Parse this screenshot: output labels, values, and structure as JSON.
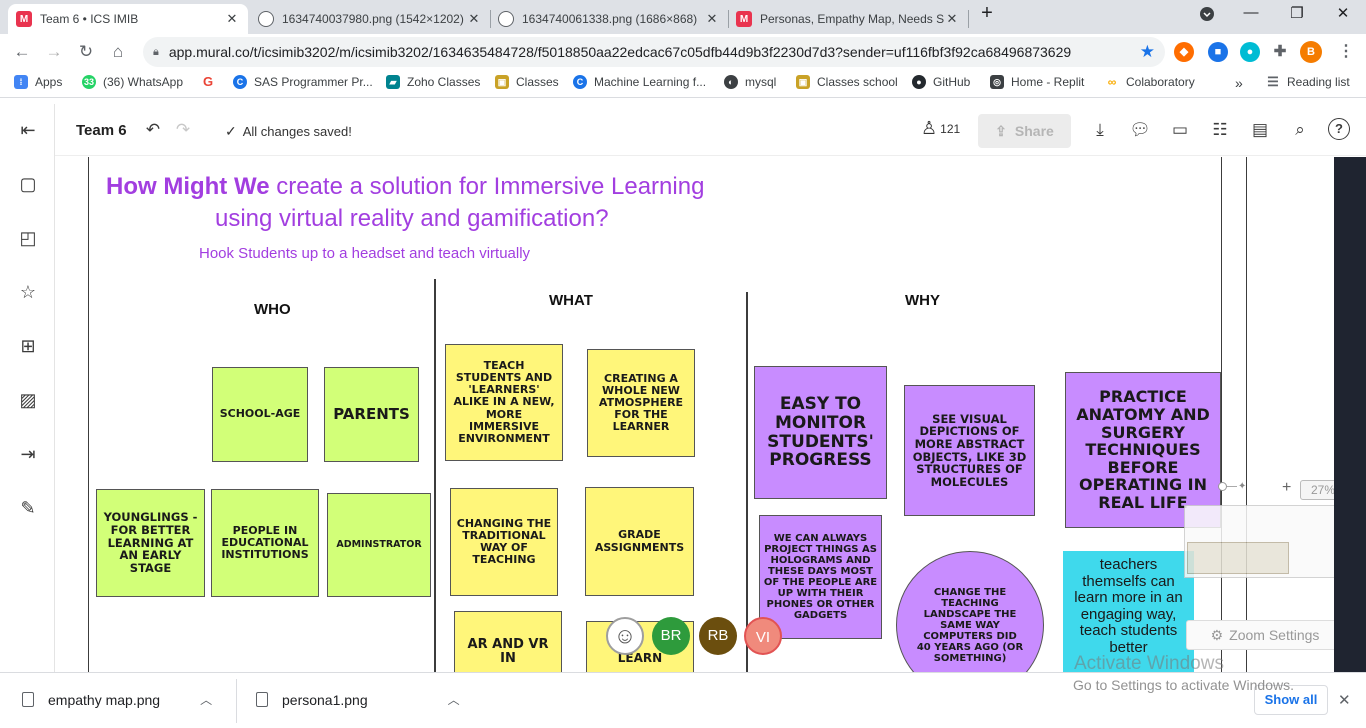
{
  "browser": {
    "tabs": [
      {
        "title": "Team 6 • ICS IMIB",
        "icon": "mural-icon",
        "close": "✕"
      },
      {
        "title": "1634740037980.png (1542×1202)",
        "icon": "globe-icon",
        "close": "✕"
      },
      {
        "title": "1634740061338.png (1686×868)",
        "icon": "globe-icon",
        "close": "✕"
      },
      {
        "title": "Personas, Empathy Map, Needs S",
        "icon": "mural-icon",
        "close": "✕"
      }
    ],
    "new_tab": "+",
    "url": "app.mural.co/t/icsimib3202/m/icsimib3202/1634635484728/f5018850aa22edcac67c05dfb44d9b3f2230d7d3?sender=uf116fbf3f92ca68496873629",
    "profile_initial": "B",
    "bookmarks": [
      {
        "label": "Apps",
        "color": "#4285f4"
      },
      {
        "label": "(36) WhatsApp",
        "color": "#25d366"
      },
      {
        "label": "",
        "color": "#ea4335"
      },
      {
        "label": "SAS Programmer Pr...",
        "color": "#1a73e8"
      },
      {
        "label": "Zoho Classes",
        "color": "#00838f"
      },
      {
        "label": "Classes",
        "color": "#c9a227"
      },
      {
        "label": "Machine Learning f...",
        "color": "#1a73e8"
      },
      {
        "label": "mysql",
        "color": "#3c4043"
      },
      {
        "label": "Classes school",
        "color": "#c9a227"
      },
      {
        "label": "GitHub",
        "color": "#24292e"
      },
      {
        "label": "Home - Replit",
        "color": "#3c4043"
      },
      {
        "label": "Colaboratory",
        "color": "#f9ab00"
      }
    ],
    "reading_list": "Reading list",
    "more_bookmarks": "»"
  },
  "mural": {
    "board_name": "Team 6",
    "save_status": "All changes saved!",
    "participants": "121",
    "share_label": "Share",
    "title_bold": "How Might We",
    "title_rest_1": "create a solution for Immersive Learning",
    "title_rest_2": "using virtual reality and gamification?",
    "subtitle": "Hook Students up to a headset and teach virtually",
    "columns": {
      "who": "WHO",
      "what": "WHAT",
      "why": "WHY"
    },
    "stickies": {
      "school_age": "School-age",
      "parents": "Parents",
      "younglings": "Younglings - for better learning at an early stage",
      "people_edu": "People in educational institutions",
      "administrator": "Adminstrator",
      "teach_students": "Teach students and 'learners' alike in a new, more immersive environment",
      "creating_atmosphere": "Creating a whole new atmosphere for the learner",
      "changing_way": "Changing the traditional way of teaching",
      "grade_assignments": "Grade assignments",
      "ar_vr": "AR and VR in",
      "learn": "learn",
      "easy_monitor": "Easy to monitor students' progress",
      "see_visual": "See visual depictions of more abstract objects, like 3D structures of molecules",
      "practice_anatomy": "Practice anatomy and surgery techniques before operating in real life",
      "holograms": "We can always project things as holograms and these days most of the people are up with their phones or other gadgets",
      "change_landscape": "Change the teaching landscape the same way computers did 40 years ago (or something)",
      "teachers": "teachers themselfs can learn more in an engaging way, teach students better"
    },
    "avatars": [
      {
        "initials": "BR",
        "color": "#2e9b3c"
      },
      {
        "initials": "RB",
        "color": "#6b4e0e"
      },
      {
        "initials": "VI",
        "color": "#f08a7c"
      }
    ],
    "self_avatar": {
      "initials": "BR",
      "color": "#2e9b3c"
    },
    "zoom_percent": "27%",
    "zoom_settings": "Zoom Settings",
    "zoom_plus": "+",
    "activate_windows_title": "Activate Windows",
    "activate_windows_sub": "Go to Settings to activate Windows."
  },
  "downloads": {
    "items": [
      {
        "name": "empathy map.png"
      },
      {
        "name": "persona1.png"
      }
    ],
    "show_all": "Show all",
    "close": "✕"
  }
}
